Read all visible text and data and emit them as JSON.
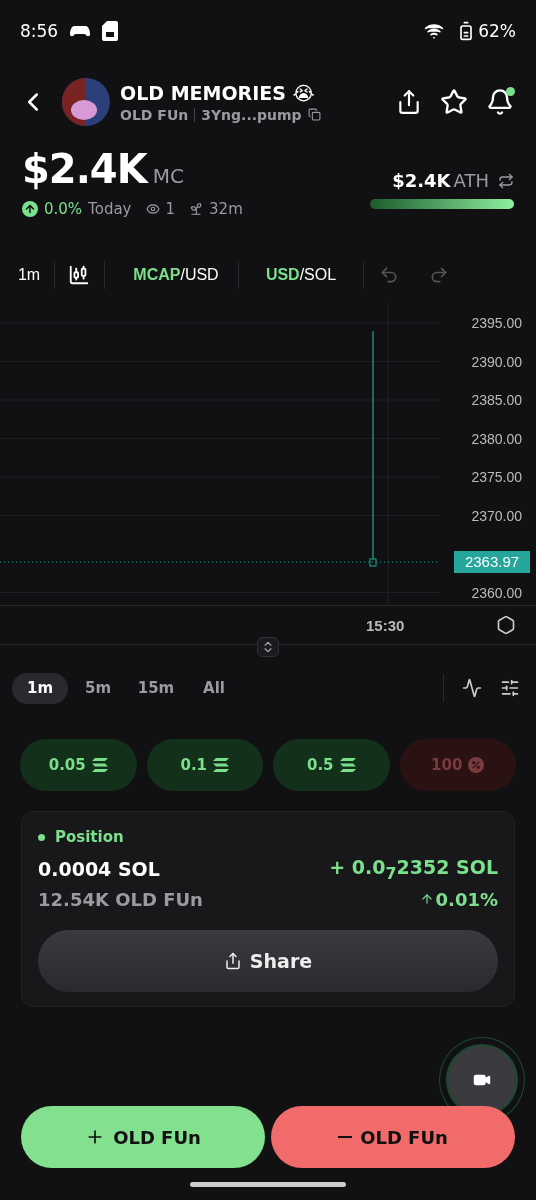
{
  "status_bar": {
    "time": "8:56",
    "battery": "62%"
  },
  "header": {
    "title": "OLD MEMORIES 😭",
    "symbol": "OLD FUn",
    "address": "3Yng...pump",
    "notification_dot": true
  },
  "stats": {
    "market_cap": "$2.4K",
    "market_cap_label": "MC",
    "change": "0.0%",
    "period": "Today",
    "watchers": "1",
    "age": "32m",
    "ath": "$2.4K",
    "ath_label": "ATH",
    "ath_bar": {
      "level": 1
    }
  },
  "toolbar": {
    "interval": "1m",
    "pairs": [
      {
        "primary": "MCAP",
        "secondary": "/USD"
      },
      {
        "primary": "USD",
        "secondary": "/SOL"
      }
    ]
  },
  "chart": {
    "time_label": "15:30",
    "price_tag": "2363.97",
    "price_labels": [
      "2395.00",
      "2390.00",
      "2385.00",
      "2380.00",
      "2375.00",
      "2370.00",
      "2360.00"
    ]
  },
  "ranges": [
    {
      "label": "1m",
      "selected": true
    },
    {
      "label": "5m",
      "selected": false
    },
    {
      "label": "15m",
      "selected": false
    },
    {
      "label": "All",
      "selected": false
    }
  ],
  "amounts": [
    {
      "label": "0.05",
      "kind": "buy"
    },
    {
      "label": "0.1",
      "kind": "buy"
    },
    {
      "label": "0.5",
      "kind": "buy"
    },
    {
      "label": "100",
      "kind": "sell"
    }
  ],
  "position": {
    "title": "Position",
    "amount": "0.0004 SOL",
    "tokens": "12.54K OLD FUn",
    "pnl": "+ 0.0$_{7}$2352 SOL",
    "change": "0.01%",
    "share": "Share"
  },
  "actions": [
    {
      "kind": "buy",
      "label": "OLD FUn"
    },
    {
      "kind": "sell",
      "label": "OLD FUn"
    }
  ]
}
